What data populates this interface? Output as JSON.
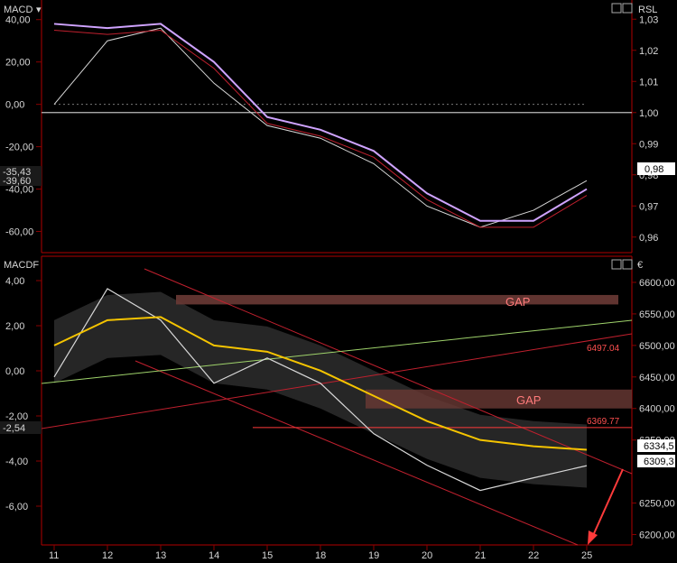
{
  "top_panel": {
    "title": "MACD",
    "right_title": "RSL",
    "left_ticks": [
      "40,00",
      "20,00",
      "0,00",
      "-20,00",
      "-40,00",
      "-60,00"
    ],
    "left_tick_values": [
      40,
      20,
      0,
      -20,
      -40,
      -60
    ],
    "right_ticks": [
      "1,03",
      "1,02",
      "1,01",
      "1,00",
      "0,99",
      "0,98",
      "0,97",
      "0,96"
    ],
    "right_tick_values": [
      1.03,
      1.02,
      1.01,
      1.0,
      0.99,
      0.98,
      0.97,
      0.96
    ],
    "left_value_label_1": "-35,43",
    "left_value_label_2": "-39,60",
    "right_value_label": "0,98"
  },
  "bottom_panel": {
    "title": "MACDF",
    "right_title": "€",
    "left_ticks": [
      "4,00",
      "2,00",
      "0,00",
      "-2,00",
      "-4,00",
      "-6,00"
    ],
    "left_tick_values": [
      4,
      2,
      0,
      -2,
      -4,
      -6
    ],
    "right_ticks": [
      "6600,00",
      "6550,00",
      "6500,00",
      "6450,00",
      "6400,00",
      "6350,00",
      "6250,00",
      "6200,00"
    ],
    "right_tick_values": [
      6600,
      6550,
      6500,
      6450,
      6400,
      6350,
      6250,
      6200
    ],
    "left_value_label": "-2,54",
    "right_value_label_1": "6334,5",
    "right_value_label_2": "6309,3",
    "annotations": {
      "gap_upper": "GAP",
      "gap_lower": "GAP",
      "level_upper": "6497.04",
      "level_lower": "6369.77"
    }
  },
  "x_axis": {
    "labels": [
      "11",
      "12",
      "13",
      "14",
      "15",
      "18",
      "19",
      "20",
      "21",
      "22",
      "25"
    ]
  },
  "colors": {
    "background": "#000000",
    "panel_border": "#c00000",
    "price": "#d8d8d8",
    "signal": "#cfa3ff",
    "trend_red": "#c0202e",
    "ma_yellow": "#f5c400",
    "band_fill": "#2f2f2f",
    "gap_box": "#6a3a35",
    "annotation_red": "#ff3b3b",
    "green_line": "#9fd36b"
  },
  "chart_data": [
    {
      "type": "line",
      "title": "MACD",
      "x": [
        "11",
        "12",
        "13",
        "14",
        "15",
        "18",
        "19",
        "20",
        "21",
        "22",
        "25"
      ],
      "series": [
        {
          "values": [
            0.0,
            30.0,
            36.0,
            10.0,
            -10.0,
            -16.0,
            -28.0,
            -48.0,
            -58.0,
            -50.0,
            -36.0
          ]
        },
        {
          "values": [
            38.0,
            36.0,
            38.0,
            20.0,
            -6.0,
            -12.0,
            -22.0,
            -42.0,
            -55.0,
            -55.0,
            -40.0
          ]
        }
      ],
      "ylim": [
        -70,
        45
      ],
      "y2_range": [
        0.955,
        1.035
      ],
      "y2_reference": 1.0
    },
    {
      "type": "line",
      "title": "MACDF",
      "x": [
        "11",
        "12",
        "13",
        "14",
        "15",
        "18",
        "19",
        "20",
        "21",
        "22",
        "25"
      ],
      "series": [
        {
          "values": [
            6450,
            6590,
            6540,
            6440,
            6480,
            6440,
            6360,
            6310,
            6270,
            6290,
            6309.3
          ]
        },
        {
          "values": [
            6500,
            6540,
            6545,
            6500,
            6490,
            6460,
            6420,
            6380,
            6350,
            6340,
            6334.5
          ]
        }
      ],
      "y_range": [
        6195,
        6630
      ],
      "levels": [
        6497.04,
        6369.77
      ],
      "gaps": [
        [
          6565,
          6580
        ],
        [
          6400,
          6430
        ]
      ]
    }
  ]
}
